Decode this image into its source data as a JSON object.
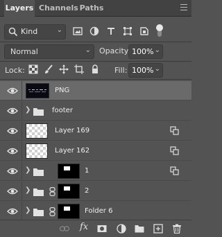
{
  "tabs": [
    {
      "label": "Layers",
      "active": true
    },
    {
      "label": "Channels",
      "active": false
    },
    {
      "label": "Paths",
      "active": false
    }
  ],
  "filter": {
    "kind_label": "Kind",
    "icons": [
      "pixel-filter-icon",
      "adjustment-filter-icon",
      "type-filter-icon",
      "shape-filter-icon",
      "smart-object-filter-icon"
    ],
    "filter_toggle": "on"
  },
  "blend": {
    "mode": "Normal",
    "opacity_label": "Opacity:",
    "opacity_value": "100%"
  },
  "lock": {
    "label": "Lock:",
    "icons": [
      "lock-transparent-pixels-icon",
      "lock-image-pixels-icon",
      "lock-position-icon",
      "lock-artboard-icon",
      "lock-all-icon"
    ],
    "fill_label": "Fill:",
    "fill_value": "100%"
  },
  "layers": [
    {
      "name": "PNG",
      "type": "image",
      "visible": true,
      "selected": true
    },
    {
      "name": "footer",
      "type": "group",
      "visible": true
    },
    {
      "name": "Layer 169",
      "type": "smart-object",
      "visible": true
    },
    {
      "name": "Layer 162",
      "type": "smart-object",
      "visible": true
    },
    {
      "name": "1",
      "type": "group-with-mask",
      "visible": true,
      "linked": false,
      "smart_badge": true
    },
    {
      "name": "2",
      "type": "group-with-mask",
      "visible": true,
      "linked": true
    },
    {
      "name": "Folder 6",
      "type": "group-with-mask",
      "visible": true,
      "linked": true
    }
  ],
  "bottom_bar": {
    "fx_label": "fx",
    "icons": [
      "link-layers-icon",
      "add-layer-style-icon",
      "add-mask-icon",
      "new-adjustment-layer-icon",
      "new-group-icon",
      "new-layer-icon",
      "delete-layer-icon"
    ]
  },
  "colors": {
    "panel_bg": "#535353",
    "tab_bar_bg": "#424242",
    "selected_row_bg": "#6a6a6a"
  }
}
